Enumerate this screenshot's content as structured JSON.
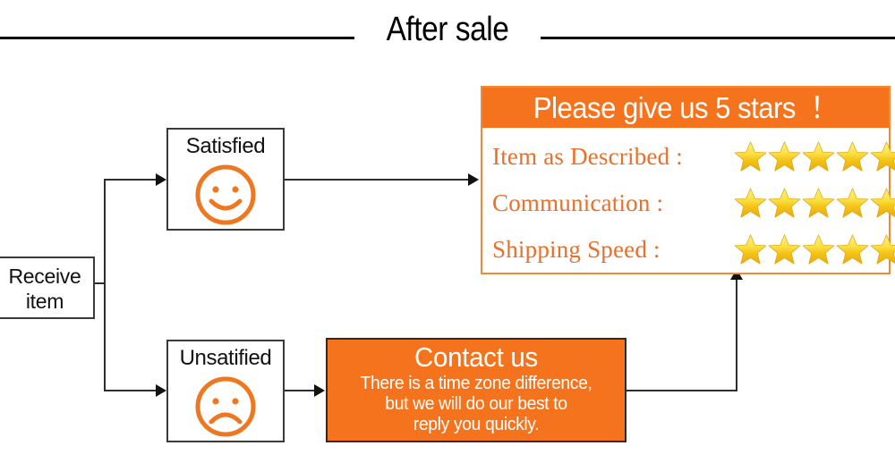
{
  "page": {
    "title": "After sale"
  },
  "flow": {
    "receive": {
      "label": "Receive\nitem"
    },
    "satisfied": {
      "label": "Satisfied",
      "face": "smiley-face-icon"
    },
    "unsatisfied": {
      "label": "Unsatified",
      "face": "sad-face-icon"
    }
  },
  "rating_panel": {
    "header": "Please give us 5 stars  ！",
    "star_filled_count": 5,
    "rows": [
      {
        "label": "Item as Described :",
        "stars": 5
      },
      {
        "label": "Communication :",
        "stars": 5
      },
      {
        "label": "Shipping Speed :",
        "stars": 5
      }
    ]
  },
  "contact_panel": {
    "title": "Contact us",
    "body": "There is a time zone difference,\nbut we will do our best to\nreply you quickly."
  },
  "colors": {
    "orange_fill": "#f4731c",
    "orange_text": "#e8702a",
    "orange_border": "#f08a33",
    "star_gold": "#f5c518",
    "star_light": "#fdf08a",
    "line_black": "#2e2e2e",
    "text_black": "#111111"
  },
  "icons": {
    "star": "star-icon",
    "smiley": "smiley-face-icon",
    "sad": "sad-face-icon"
  }
}
